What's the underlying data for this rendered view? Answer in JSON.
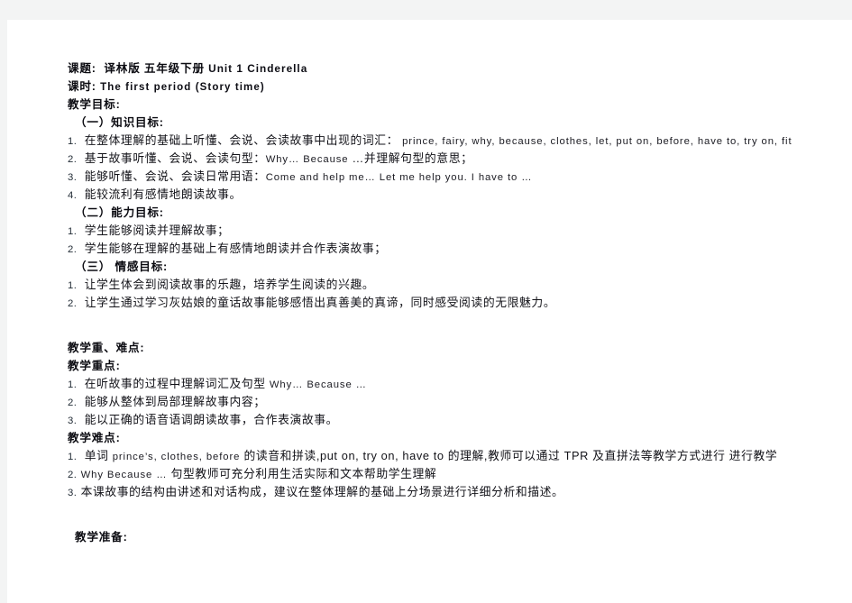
{
  "document": {
    "title_field_label": "课题:",
    "title_value": "译林版 五年级下册",
    "title_value_en": "Unit 1 Cinderella",
    "period_label": "课时:",
    "period_value": "The first period (Story time)",
    "sections": [
      {
        "id": "teaching-objectives",
        "heading": "教学目标:",
        "subsections": [
          {
            "id": "knowledge-objectives",
            "heading": "（一）知识目标:",
            "items": [
              {
                "num": "1.",
                "cn": "在整体理解的基础上听懂、会说、会读故事中出现的词汇：",
                "en": "prince, fairy, why, because, clothes, let, put on, before, have to, try on, fit",
                "cn_tail": ""
              },
              {
                "num": "2.",
                "cn": "基于故事听懂、会说、会读句型：",
                "en": "Why…  Because  ",
                "cn_tail": "…并理解句型的意思；"
              },
              {
                "num": "3.",
                "cn": "能够听懂、会说、会读日常用语：",
                "en": "Come and help me…  Let me help you. I have to  …",
                "cn_tail": ""
              },
              {
                "num": "4.",
                "cn": "能较流利有感情地朗读故事。",
                "en": "",
                "cn_tail": ""
              }
            ]
          },
          {
            "id": "ability-objectives",
            "heading": "（二）能力目标:",
            "items": [
              {
                "num": "1.",
                "cn": "学生能够阅读并理解故事；",
                "en": "",
                "cn_tail": ""
              },
              {
                "num": "2.",
                "cn": " 学生能够在理解的基础上有感情地朗读并合作表演故事；",
                "en": "",
                "cn_tail": ""
              }
            ]
          },
          {
            "id": "emotional-objectives",
            "heading": "（三） 情感目标:",
            "items": [
              {
                "num": "1.",
                "cn": "让学生体会到阅读故事的乐趣，培养学生阅读的兴趣。",
                "en": "",
                "cn_tail": ""
              },
              {
                "num": "2.",
                "cn": "让学生通过学习灰姑娘的童话故事能够感悟出真善美的真谛，同时感受阅读的无限魅力。",
                "en": "",
                "cn_tail": ""
              }
            ]
          }
        ]
      },
      {
        "id": "key-difficult-points",
        "heading": "教学重、难点:",
        "subsections": [
          {
            "id": "key-points",
            "heading": "教学重点:",
            "items": [
              {
                "num": "1.",
                "cn": "  在听故事的过程中理解词汇及句型 ",
                "en": "Why…  Because  …",
                "cn_tail": ""
              },
              {
                "num": "2.",
                "cn": "  能够从整体到局部理解故事内容；",
                "en": "",
                "cn_tail": ""
              },
              {
                "num": "3.",
                "cn": "  能以正确的语音语调朗读故事，合作表演故事。",
                "en": "",
                "cn_tail": ""
              }
            ]
          },
          {
            "id": "difficult-points",
            "heading": "教学难点:",
            "items": [
              {
                "num": "1.",
                "cn": " 单词 ",
                "en": "prince’s, clothes, before",
                "cn_tail": " 的读音和拼读,put on, try on, have to 的理解,教师可以通过 TPR 及直拼法等教学方式进行 进行教学"
              },
              {
                "num": "2.",
                "cn": " ",
                "en": "Why Because  …",
                "cn_tail": "  句型教师可充分利用生活实际和文本帮助学生理解"
              },
              {
                "num": "3.",
                "cn": " 本课故事的结构由讲述和对话构成，建议在整体理解的基础上分场景进行详细分析和描述。",
                "en": "",
                "cn_tail": ""
              }
            ]
          }
        ]
      },
      {
        "id": "teaching-preparation",
        "heading": "教学准备:",
        "subsections": []
      }
    ]
  }
}
